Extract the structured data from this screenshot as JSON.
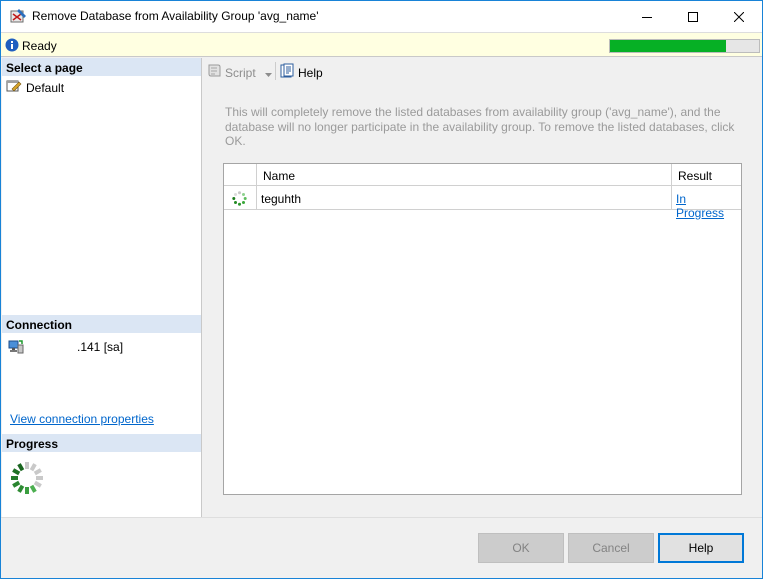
{
  "window": {
    "title": "Remove Database from Availability Group 'avg_name'"
  },
  "status": {
    "text": "Ready",
    "progress_fraction": 0.78,
    "progress_color": "#06b025"
  },
  "left": {
    "select_page_header": "Select a page",
    "pages": [
      {
        "label": "Default",
        "icon": "page-wrench-icon"
      }
    ],
    "connection_header": "Connection",
    "connection_text": ".141 [sa]",
    "connection_link": "View connection properties",
    "progress_header": "Progress"
  },
  "toolbar": {
    "script_label": "Script",
    "help_label": "Help"
  },
  "main": {
    "description": "This will completely remove the listed databases from availability group ('avg_name'), and the database will no longer participate in the availability group. To remove the listed databases, click OK.",
    "columns": [
      "Name",
      "Result"
    ],
    "rows": [
      {
        "name": "teguhth",
        "result": "In Progress",
        "status_icon": "spinner-icon"
      }
    ]
  },
  "footer": {
    "ok_label": "OK",
    "cancel_label": "Cancel",
    "help_label": "Help"
  },
  "colors": {
    "accent": "#0078d7",
    "link": "#0066cc",
    "section_header": "#dbe6f4",
    "status_bg": "#ffffe1"
  }
}
